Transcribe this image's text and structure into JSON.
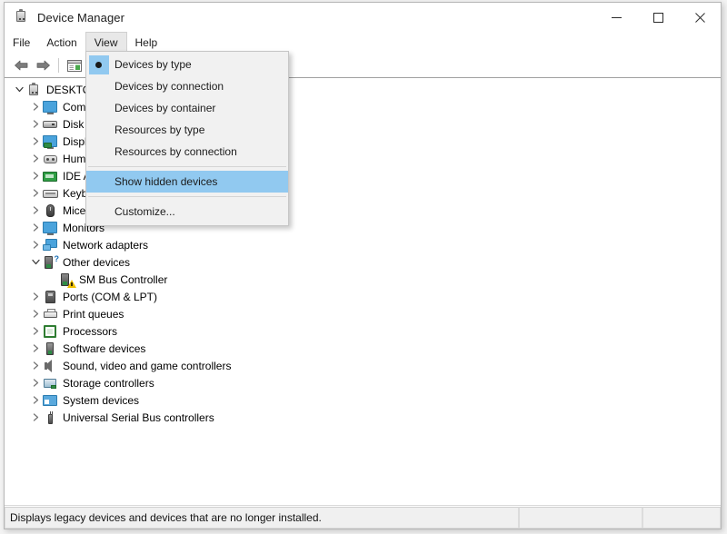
{
  "window": {
    "title": "Device Manager",
    "icon": "device-manager-icon",
    "controls": {
      "minimize": "−",
      "maximize": "□",
      "close": "✕"
    }
  },
  "menubar": {
    "items": [
      {
        "label": "File",
        "open": false
      },
      {
        "label": "Action",
        "open": false
      },
      {
        "label": "View",
        "open": true
      },
      {
        "label": "Help",
        "open": false
      }
    ]
  },
  "toolbar": {
    "buttons": [
      {
        "name": "back-button",
        "icon": "back-arrow-icon"
      },
      {
        "name": "forward-button",
        "icon": "forward-arrow-icon"
      },
      {
        "name": "properties-button",
        "icon": "properties-icon"
      }
    ]
  },
  "view_menu": {
    "items": [
      {
        "label": "Devices by type",
        "type": "radio",
        "checked": true,
        "highlighted": false
      },
      {
        "label": "Devices by connection",
        "type": "radio",
        "checked": false,
        "highlighted": false
      },
      {
        "label": "Devices by container",
        "type": "radio",
        "checked": false,
        "highlighted": false
      },
      {
        "label": "Resources by type",
        "type": "radio",
        "checked": false,
        "highlighted": false
      },
      {
        "label": "Resources by connection",
        "type": "radio",
        "checked": false,
        "highlighted": false
      },
      {
        "separator": true
      },
      {
        "label": "Show hidden devices",
        "type": "toggle",
        "checked": false,
        "highlighted": true
      },
      {
        "separator": true
      },
      {
        "label": "Customize...",
        "type": "command",
        "checked": false,
        "highlighted": false
      }
    ],
    "highlight_color": "#91c9f0"
  },
  "tree": {
    "root": {
      "label": "DESKTOP",
      "icon": "computer-icon",
      "expanded": true,
      "indent": 0
    },
    "nodes": [
      {
        "label": "Computer",
        "icon": "monitor-icon",
        "expanded": false,
        "indent": 1
      },
      {
        "label": "Disk drives",
        "icon": "disk-icon",
        "expanded": false,
        "indent": 1
      },
      {
        "label": "Display adapters",
        "icon": "display-adapter-icon",
        "expanded": false,
        "indent": 1
      },
      {
        "label": "Human Interface Devices",
        "icon": "hid-icon",
        "expanded": false,
        "indent": 1
      },
      {
        "label": "IDE ATA/ATAPI controllers",
        "icon": "ide-controller-icon",
        "expanded": false,
        "indent": 1
      },
      {
        "label": "Keyboards",
        "icon": "keyboard-icon",
        "expanded": false,
        "indent": 1
      },
      {
        "label": "Mice and other pointing devices",
        "icon": "mouse-icon",
        "expanded": false,
        "indent": 1
      },
      {
        "label": "Monitors",
        "icon": "monitor-icon",
        "expanded": false,
        "indent": 1
      },
      {
        "label": "Network adapters",
        "icon": "network-adapter-icon",
        "expanded": false,
        "indent": 1
      },
      {
        "label": "Other devices",
        "icon": "other-devices-icon",
        "expanded": true,
        "indent": 1
      },
      {
        "label": "SM Bus Controller",
        "icon": "warning-device-icon",
        "expanded": null,
        "indent": 2
      },
      {
        "label": "Ports (COM & LPT)",
        "icon": "port-icon",
        "expanded": false,
        "indent": 1
      },
      {
        "label": "Print queues",
        "icon": "printer-icon",
        "expanded": false,
        "indent": 1
      },
      {
        "label": "Processors",
        "icon": "processor-icon",
        "expanded": false,
        "indent": 1
      },
      {
        "label": "Software devices",
        "icon": "software-device-icon",
        "expanded": false,
        "indent": 1
      },
      {
        "label": "Sound, video and game controllers",
        "icon": "speaker-icon",
        "expanded": false,
        "indent": 1
      },
      {
        "label": "Storage controllers",
        "icon": "storage-controller-icon",
        "expanded": false,
        "indent": 1
      },
      {
        "label": "System devices",
        "icon": "system-device-icon",
        "expanded": false,
        "indent": 1
      },
      {
        "label": "Universal Serial Bus controllers",
        "icon": "usb-icon",
        "expanded": false,
        "indent": 1
      }
    ]
  },
  "statusbar": {
    "message": "Displays legacy devices and devices that are no longer installed.",
    "pane2": "",
    "pane3": ""
  }
}
